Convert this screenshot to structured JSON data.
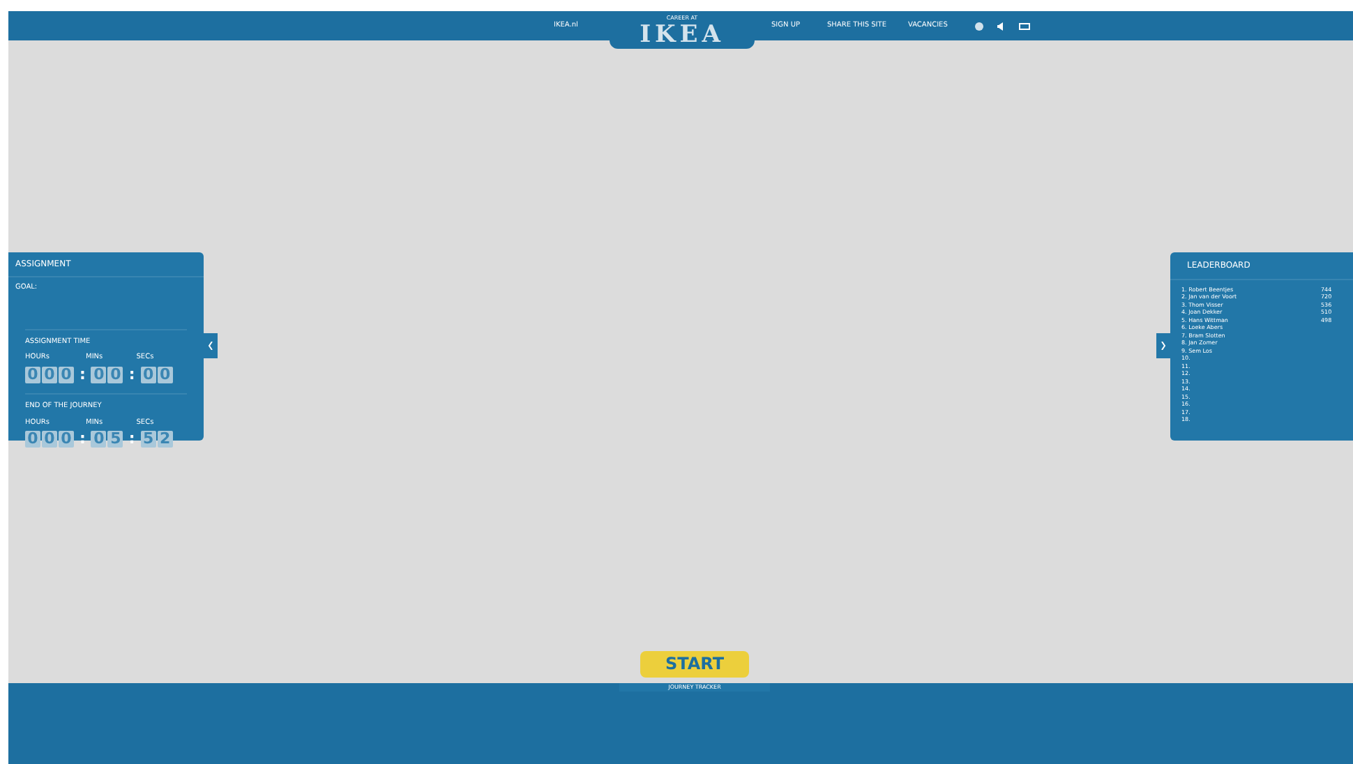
{
  "nav": {
    "left_link": "IKEA.nl",
    "logo_caption": "CAREER AT",
    "logo": "IKEA",
    "links": [
      "SIGN UP",
      "SHARE THIS SITE",
      "VACANCIES"
    ]
  },
  "assignment": {
    "title": "ASSIGNMENT",
    "goal_label": "GOAL:",
    "timers": [
      {
        "title": "ASSIGNMENT TIME",
        "units": [
          "HOURs",
          "MINs",
          "SECs"
        ],
        "groups": [
          [
            "0",
            "0",
            "0"
          ],
          [
            "0",
            "0"
          ],
          [
            "0",
            "0"
          ]
        ],
        "separator": ":"
      },
      {
        "title": "END OF THE JOURNEY",
        "units": [
          "HOURs",
          "MINs",
          "SECs"
        ],
        "groups": [
          [
            "0",
            "0",
            "0"
          ],
          [
            "0",
            "5"
          ],
          [
            "5",
            "2"
          ]
        ],
        "separator": ":"
      }
    ]
  },
  "leaderboard": {
    "title": "LEADERBOARD",
    "rows": [
      {
        "rank": "1.",
        "name": "Robert Beentjes",
        "score": "744"
      },
      {
        "rank": "2.",
        "name": "Jan van der Voort",
        "score": "720"
      },
      {
        "rank": "3.",
        "name": "Thom Visser",
        "score": "536"
      },
      {
        "rank": "4.",
        "name": "Joan Dekker",
        "score": "510"
      },
      {
        "rank": "5.",
        "name": "Hans Wittman",
        "score": "498"
      },
      {
        "rank": "6.",
        "name": "Loeke Abers"
      },
      {
        "rank": "7.",
        "name": "Bram Slotten"
      },
      {
        "rank": "8.",
        "name": "Jan Zomer"
      },
      {
        "rank": "9.",
        "name": "Sem Los"
      },
      {
        "rank": "10."
      },
      {
        "rank": "11."
      },
      {
        "rank": "12."
      },
      {
        "rank": "13."
      },
      {
        "rank": "14."
      },
      {
        "rank": "15."
      },
      {
        "rank": "16."
      },
      {
        "rank": "17."
      },
      {
        "rank": "18."
      }
    ]
  },
  "start_button": "START",
  "journey_tracker": "JOURNEY TRACKER"
}
